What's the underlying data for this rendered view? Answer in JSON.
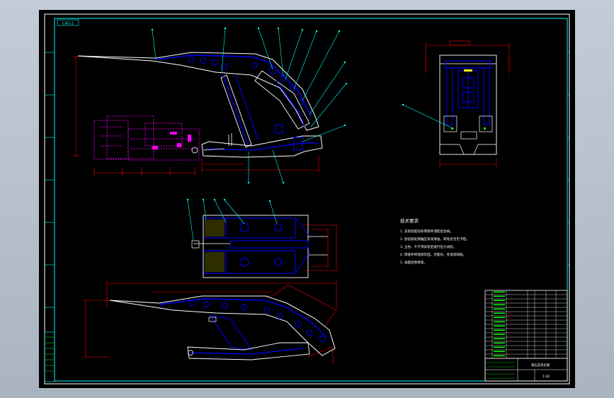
{
  "drawing": {
    "tag": "CAD-2",
    "notes_title": "技术要求",
    "notes": [
      "1. 支架装配前各零部件须检验合格。",
      "2. 各铰接处销轴应涂润滑油，转动灵活无卡阻。",
      "3. 立柱、千斤顶安装后进行压力试验。",
      "4. 焊接件焊缝须牢固，无裂纹、夹渣等缺陷。",
      "5. 表面涂防锈漆。"
    ],
    "title_block": {
      "name": "液压支架总图",
      "scale": "1:40"
    }
  },
  "colors": {
    "background": "#000000",
    "border": "#ffffff",
    "frame": "#00ffff",
    "part": "#0000ff",
    "accent": "#ff0000",
    "aux": "#ff00ff",
    "text": "#ffffff"
  }
}
